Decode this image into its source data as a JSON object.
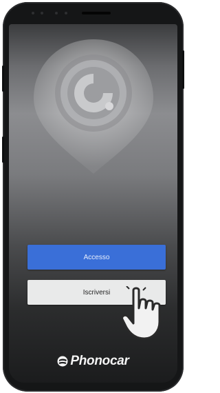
{
  "screen": {
    "login_button": "Accesso",
    "signup_button": "Iscriversi"
  },
  "brand": {
    "name": "Phonocar"
  },
  "colors": {
    "accent": "#3a6fd8",
    "secondary_button": "#e9eaea",
    "device_frame": "#151617"
  },
  "icons": {
    "app_logo": "camera-pin-icon",
    "pointer": "hand-pointer-icon",
    "brand_mark": "phonocar-mark-icon"
  }
}
